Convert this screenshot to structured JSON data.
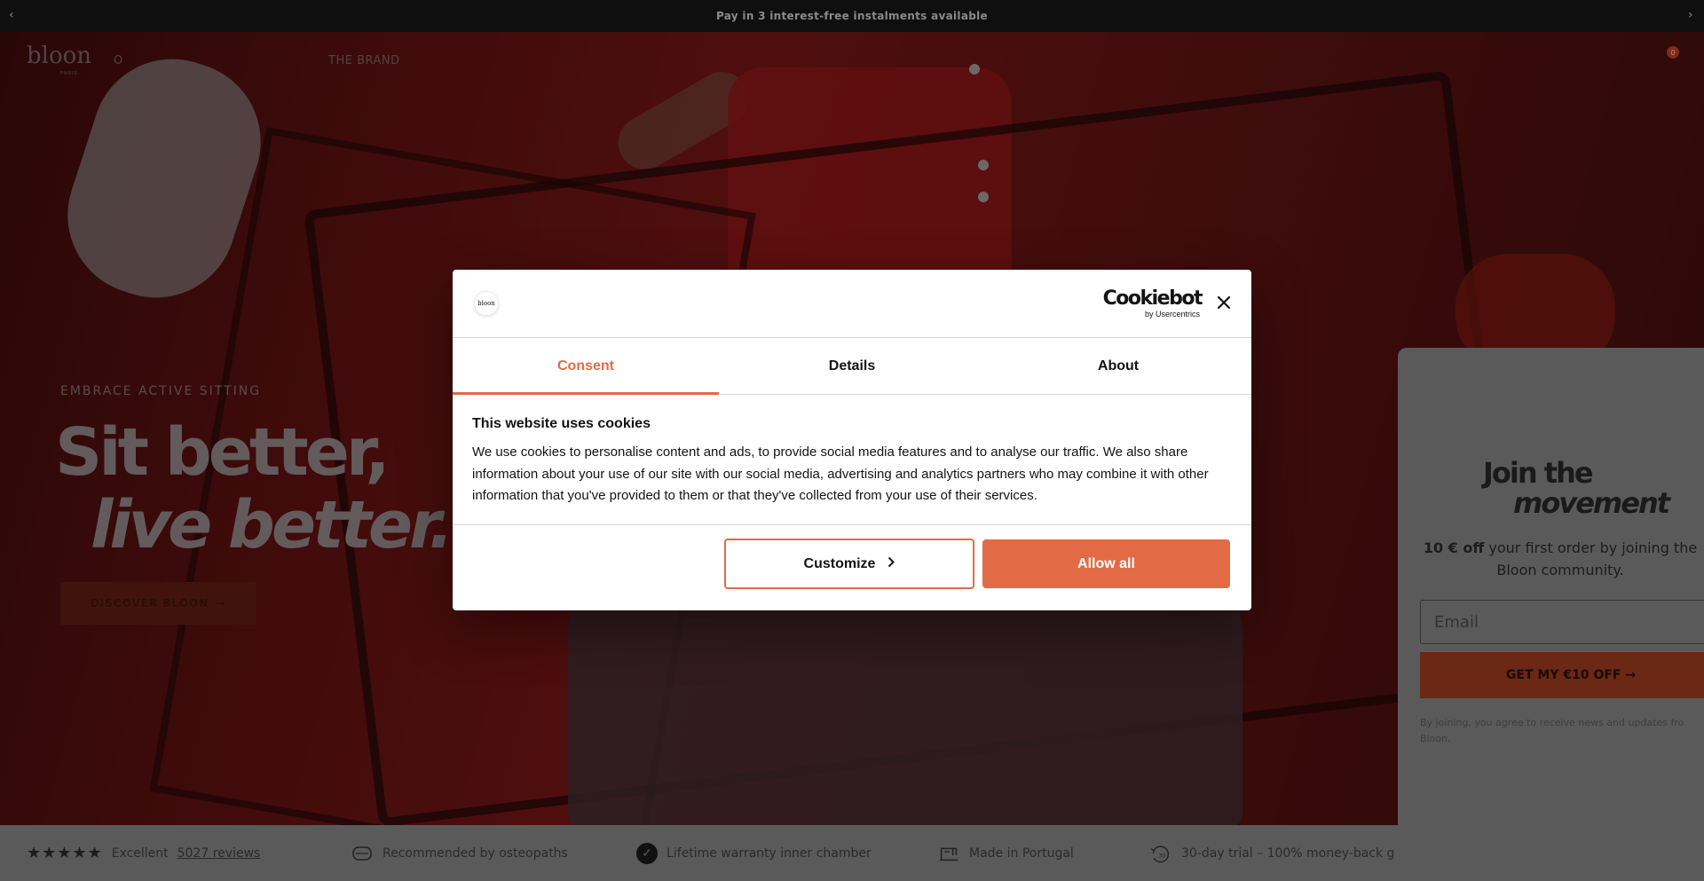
{
  "announcement": {
    "text": "Pay in 3 interest-free instalments available",
    "prev_icon": "chevron-left-icon",
    "next_icon": "chevron-right-icon"
  },
  "header": {
    "logo": "bloon",
    "logo_sub": "PARIS",
    "nav": [
      {
        "label": "O"
      },
      {
        "label": "THE BRAND"
      }
    ],
    "cart_count": "0"
  },
  "hero": {
    "eyebrow": "EMBRACE ACTIVE SITTING",
    "headline_line1": "Sit better,",
    "headline_line2": "live better.",
    "cta_label": "DISCOVER BLOON",
    "cta_icon": "arrow-right-icon"
  },
  "trust_bar": {
    "rating_label": "Excellent",
    "reviews_link": "5027 reviews",
    "items": [
      {
        "icon": "cushion-icon",
        "label": "Recommended by osteopaths"
      },
      {
        "icon": "check-circle-icon",
        "label": "Lifetime warranty inner chamber"
      },
      {
        "icon": "sewing-machine-icon",
        "label": "Made in Portugal"
      },
      {
        "icon": "thirty-day-return-icon",
        "label": "30-day trial – 100% money-back g"
      }
    ]
  },
  "newsletter": {
    "title_line1": "Join the",
    "title_line2": "movement",
    "offer_bold": "10 € off",
    "offer_rest": "your first order by joining the Bloon community.",
    "email_placeholder": "Email",
    "button_label": "GET MY €10 OFF →",
    "fine_print": "By joining, you agree to receive news and updates fro Bloon."
  },
  "cookie_dialog": {
    "brand_word": "Cookiebot",
    "brand_sub": "by Usercentrics",
    "logo_text": "bloon",
    "tabs": [
      {
        "label": "Consent",
        "active": true
      },
      {
        "label": "Details",
        "active": false
      },
      {
        "label": "About",
        "active": false
      }
    ],
    "title": "This website uses cookies",
    "body": "We use cookies to personalise content and ads, to provide social media features and to analyse our traffic. We also share information about your use of our site with our social media, advertising and analytics partners who may combine it with other information that you've provided to them or that they've collected from your use of their services.",
    "customize_label": "Customize",
    "allow_label": "Allow all",
    "accent_color": "#e26b45"
  }
}
